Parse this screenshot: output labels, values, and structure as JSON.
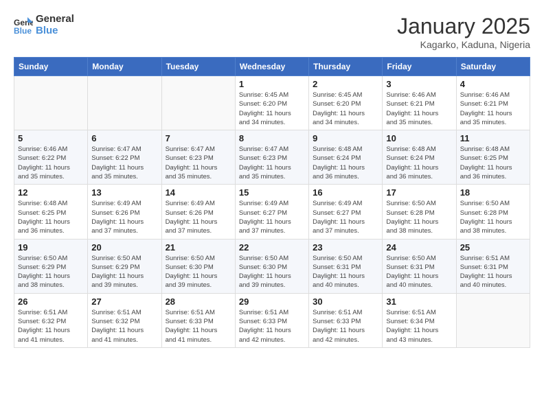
{
  "header": {
    "logo_line1": "General",
    "logo_line2": "Blue",
    "month_title": "January 2025",
    "subtitle": "Kagarko, Kaduna, Nigeria"
  },
  "days_of_week": [
    "Sunday",
    "Monday",
    "Tuesday",
    "Wednesday",
    "Thursday",
    "Friday",
    "Saturday"
  ],
  "weeks": [
    [
      {
        "day": "",
        "info": ""
      },
      {
        "day": "",
        "info": ""
      },
      {
        "day": "",
        "info": ""
      },
      {
        "day": "1",
        "info": "Sunrise: 6:45 AM\nSunset: 6:20 PM\nDaylight: 11 hours\nand 34 minutes."
      },
      {
        "day": "2",
        "info": "Sunrise: 6:45 AM\nSunset: 6:20 PM\nDaylight: 11 hours\nand 34 minutes."
      },
      {
        "day": "3",
        "info": "Sunrise: 6:46 AM\nSunset: 6:21 PM\nDaylight: 11 hours\nand 35 minutes."
      },
      {
        "day": "4",
        "info": "Sunrise: 6:46 AM\nSunset: 6:21 PM\nDaylight: 11 hours\nand 35 minutes."
      }
    ],
    [
      {
        "day": "5",
        "info": "Sunrise: 6:46 AM\nSunset: 6:22 PM\nDaylight: 11 hours\nand 35 minutes."
      },
      {
        "day": "6",
        "info": "Sunrise: 6:47 AM\nSunset: 6:22 PM\nDaylight: 11 hours\nand 35 minutes."
      },
      {
        "day": "7",
        "info": "Sunrise: 6:47 AM\nSunset: 6:23 PM\nDaylight: 11 hours\nand 35 minutes."
      },
      {
        "day": "8",
        "info": "Sunrise: 6:47 AM\nSunset: 6:23 PM\nDaylight: 11 hours\nand 35 minutes."
      },
      {
        "day": "9",
        "info": "Sunrise: 6:48 AM\nSunset: 6:24 PM\nDaylight: 11 hours\nand 36 minutes."
      },
      {
        "day": "10",
        "info": "Sunrise: 6:48 AM\nSunset: 6:24 PM\nDaylight: 11 hours\nand 36 minutes."
      },
      {
        "day": "11",
        "info": "Sunrise: 6:48 AM\nSunset: 6:25 PM\nDaylight: 11 hours\nand 36 minutes."
      }
    ],
    [
      {
        "day": "12",
        "info": "Sunrise: 6:48 AM\nSunset: 6:25 PM\nDaylight: 11 hours\nand 36 minutes."
      },
      {
        "day": "13",
        "info": "Sunrise: 6:49 AM\nSunset: 6:26 PM\nDaylight: 11 hours\nand 37 minutes."
      },
      {
        "day": "14",
        "info": "Sunrise: 6:49 AM\nSunset: 6:26 PM\nDaylight: 11 hours\nand 37 minutes."
      },
      {
        "day": "15",
        "info": "Sunrise: 6:49 AM\nSunset: 6:27 PM\nDaylight: 11 hours\nand 37 minutes."
      },
      {
        "day": "16",
        "info": "Sunrise: 6:49 AM\nSunset: 6:27 PM\nDaylight: 11 hours\nand 37 minutes."
      },
      {
        "day": "17",
        "info": "Sunrise: 6:50 AM\nSunset: 6:28 PM\nDaylight: 11 hours\nand 38 minutes."
      },
      {
        "day": "18",
        "info": "Sunrise: 6:50 AM\nSunset: 6:28 PM\nDaylight: 11 hours\nand 38 minutes."
      }
    ],
    [
      {
        "day": "19",
        "info": "Sunrise: 6:50 AM\nSunset: 6:29 PM\nDaylight: 11 hours\nand 38 minutes."
      },
      {
        "day": "20",
        "info": "Sunrise: 6:50 AM\nSunset: 6:29 PM\nDaylight: 11 hours\nand 39 minutes."
      },
      {
        "day": "21",
        "info": "Sunrise: 6:50 AM\nSunset: 6:30 PM\nDaylight: 11 hours\nand 39 minutes."
      },
      {
        "day": "22",
        "info": "Sunrise: 6:50 AM\nSunset: 6:30 PM\nDaylight: 11 hours\nand 39 minutes."
      },
      {
        "day": "23",
        "info": "Sunrise: 6:50 AM\nSunset: 6:31 PM\nDaylight: 11 hours\nand 40 minutes."
      },
      {
        "day": "24",
        "info": "Sunrise: 6:50 AM\nSunset: 6:31 PM\nDaylight: 11 hours\nand 40 minutes."
      },
      {
        "day": "25",
        "info": "Sunrise: 6:51 AM\nSunset: 6:31 PM\nDaylight: 11 hours\nand 40 minutes."
      }
    ],
    [
      {
        "day": "26",
        "info": "Sunrise: 6:51 AM\nSunset: 6:32 PM\nDaylight: 11 hours\nand 41 minutes."
      },
      {
        "day": "27",
        "info": "Sunrise: 6:51 AM\nSunset: 6:32 PM\nDaylight: 11 hours\nand 41 minutes."
      },
      {
        "day": "28",
        "info": "Sunrise: 6:51 AM\nSunset: 6:33 PM\nDaylight: 11 hours\nand 41 minutes."
      },
      {
        "day": "29",
        "info": "Sunrise: 6:51 AM\nSunset: 6:33 PM\nDaylight: 11 hours\nand 42 minutes."
      },
      {
        "day": "30",
        "info": "Sunrise: 6:51 AM\nSunset: 6:33 PM\nDaylight: 11 hours\nand 42 minutes."
      },
      {
        "day": "31",
        "info": "Sunrise: 6:51 AM\nSunset: 6:34 PM\nDaylight: 11 hours\nand 43 minutes."
      },
      {
        "day": "",
        "info": ""
      }
    ]
  ]
}
